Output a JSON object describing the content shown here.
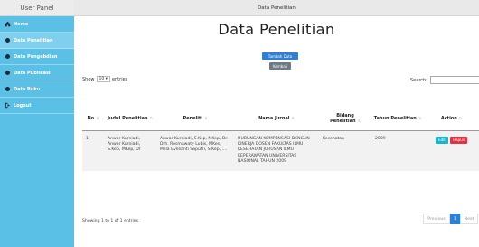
{
  "sidebar": {
    "title": "User Panel",
    "items": [
      {
        "label": "Home",
        "icon": "home-icon"
      },
      {
        "label": "Data Penelitian",
        "icon": "circle-icon"
      },
      {
        "label": "Data Pengabdian",
        "icon": "circle-icon"
      },
      {
        "label": "Data Publikasi",
        "icon": "circle-icon"
      },
      {
        "label": "Data Buku",
        "icon": "circle-icon"
      },
      {
        "label": "Logout",
        "icon": "logout-icon"
      }
    ]
  },
  "topbar": {
    "title": "Data Penelitian"
  },
  "page": {
    "title": "Data Penelitian",
    "add_label": "Tambah Data",
    "back_label": "Kembali"
  },
  "table_controls": {
    "show_label": "Show",
    "entries_value": "10",
    "entries_label": "entries",
    "search_label": "Search:"
  },
  "table": {
    "columns": [
      "No",
      "Judul Penelitian",
      "Peneliti",
      "Nama Jurnal",
      "Bidang Penelitian",
      "Tahun Penelitian",
      "Action"
    ],
    "rows": [
      {
        "no": "1",
        "judul": "Anwar Kurniadi, Anwar Kurniadi, S.Kep, MKep, Dr",
        "peneliti": "Anwar Kurniadi, S.Kep, MKep, Dr. Drh. Rosmawaty Lubis, MKes, Milla Evelianti Saputri, S.Kep, ....",
        "jurnal": "HUBUNGAN KOMPENSASI DENGAN KINERJA DOSEN FAKULTAS ILMU KESEHATAN JURUSAN ILMU KEPERAWATAN UNIVERSITAS NASIONAL TAHUN 2009",
        "bidang": "Kesehatan",
        "tahun": "2009",
        "edit_label": "Edit",
        "delete_label": "Hapus"
      }
    ]
  },
  "footer": {
    "info": "Showing 1 to 1 of 1 entries",
    "prev": "Previous",
    "page": "1",
    "next": "Next"
  },
  "colors": {
    "sidebar": "#5bc0e6",
    "primary": "#2f7fd3",
    "secondary": "#6e7b85",
    "edit": "#17b6c9",
    "delete": "#dc3545"
  }
}
